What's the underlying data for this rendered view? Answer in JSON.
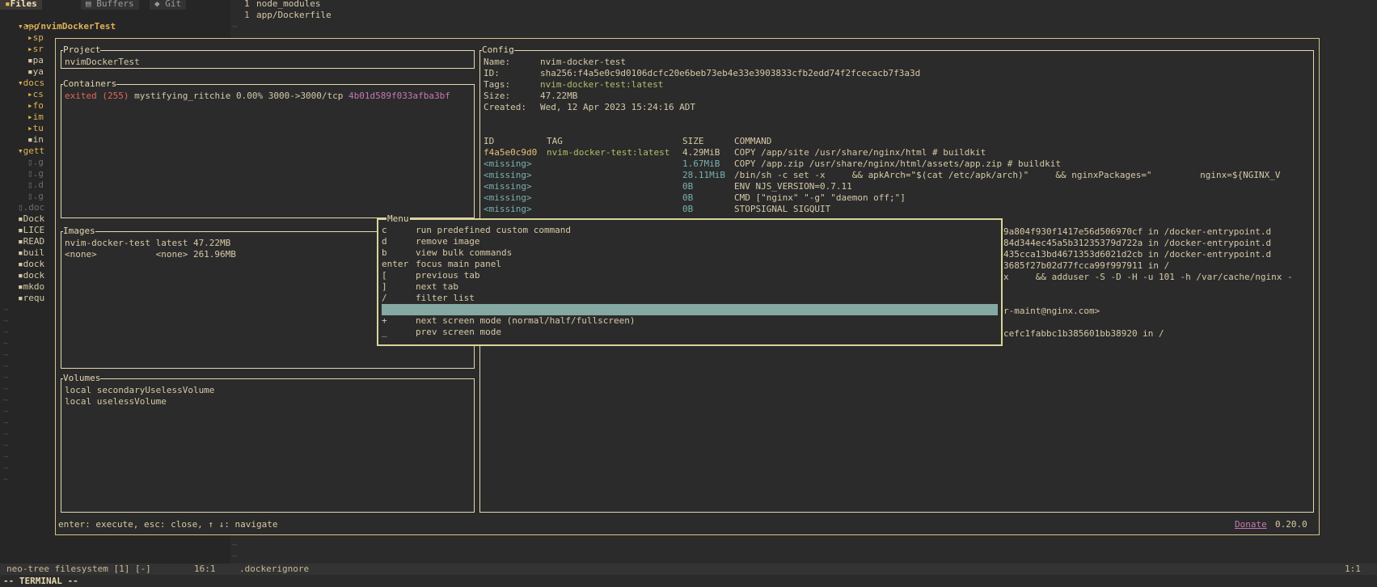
{
  "tabs": {
    "files": "Files",
    "buffers": "Buffers",
    "git": "Git"
  },
  "tree": {
    "root": "~/nvimDockerTest",
    "rows": [
      {
        "indent": 1,
        "icon": "▾",
        "name": "app",
        "type": "dir"
      },
      {
        "indent": 2,
        "icon": "▸",
        "name": "sp",
        "type": "dir"
      },
      {
        "indent": 2,
        "icon": "▸",
        "name": "sr",
        "type": "dir"
      },
      {
        "indent": 2,
        "icon": "",
        "name": "pa",
        "type": "file"
      },
      {
        "indent": 2,
        "icon": "",
        "name": "ya",
        "type": "file"
      },
      {
        "indent": 1,
        "icon": "▾",
        "name": "docs",
        "type": "dir"
      },
      {
        "indent": 2,
        "icon": "▸",
        "name": "cs",
        "type": "dir"
      },
      {
        "indent": 2,
        "icon": "▸",
        "name": "fo",
        "type": "dir"
      },
      {
        "indent": 2,
        "icon": "▸",
        "name": "im",
        "type": "dir"
      },
      {
        "indent": 2,
        "icon": "▸",
        "name": "tu",
        "type": "dir"
      },
      {
        "indent": 2,
        "icon": "",
        "name": "in",
        "type": "file"
      },
      {
        "indent": 1,
        "icon": "▾",
        "name": "gett",
        "type": "dir"
      },
      {
        "indent": 2,
        "icon": "",
        "name": ".g",
        "type": "hidden"
      },
      {
        "indent": 2,
        "icon": "",
        "name": ".g",
        "type": "hidden"
      },
      {
        "indent": 2,
        "icon": "",
        "name": ".d",
        "type": "hidden"
      },
      {
        "indent": 2,
        "icon": "",
        "name": ".g",
        "type": "hidden"
      },
      {
        "indent": 1,
        "icon": "",
        "name": ".doc",
        "type": "hidden"
      },
      {
        "indent": 1,
        "icon": "",
        "name": "Dock",
        "type": "file"
      },
      {
        "indent": 1,
        "icon": "",
        "name": "LICE",
        "type": "file"
      },
      {
        "indent": 1,
        "icon": "",
        "name": "READ",
        "type": "file"
      },
      {
        "indent": 1,
        "icon": "",
        "name": "buil",
        "type": "file"
      },
      {
        "indent": 1,
        "icon": "",
        "name": "dock",
        "type": "file"
      },
      {
        "indent": 1,
        "icon": "",
        "name": "dock",
        "type": "file"
      },
      {
        "indent": 1,
        "icon": "",
        "name": "mkdo",
        "type": "file"
      },
      {
        "indent": 1,
        "icon": "",
        "name": "requ",
        "type": "file"
      }
    ]
  },
  "file": {
    "lines": [
      {
        "num": "1",
        "text": "node_modules"
      },
      {
        "num": "1",
        "text": "app/Dockerfile"
      }
    ]
  },
  "lazydocker": {
    "project": {
      "title": "Project",
      "name": "nvimDockerTest"
    },
    "containers": {
      "title": "Containers",
      "row": {
        "status": "exited (255)",
        "name": "mystifying_ritchie",
        "cpu": "0.00%",
        "ports": "3000->3000/tcp",
        "id": "4b01d589f033afba3bf"
      }
    },
    "images": {
      "title": "Images",
      "rows": [
        "nvim-docker-test latest 47.22MB",
        "<none>           <none> 261.96MB"
      ]
    },
    "volumes": {
      "title": "Volumes",
      "rows": [
        "local secondaryUselessVolume",
        "local uselessVolume"
      ]
    },
    "config": {
      "title": "Config",
      "fields": [
        {
          "label": "Name:",
          "value": "nvim-docker-test"
        },
        {
          "label": "ID:",
          "value": "sha256:f4a5e0c9d0106dcfc20e6beb73eb4e33e3903833cfb2edd74f2fcecacb7f3a3d"
        },
        {
          "label": "Tags:",
          "value": "nvim-docker-test:latest"
        },
        {
          "label": "Size:",
          "value": "47.22MB"
        },
        {
          "label": "Created:",
          "value": "Wed, 12 Apr 2023 15:24:16 ADT"
        }
      ],
      "history_header": [
        "ID",
        "TAG",
        "SIZE",
        "COMMAND"
      ],
      "history": [
        {
          "id": "f4a5e0c9d0",
          "tag": "nvim-docker-test:latest",
          "size": "4.29MiB",
          "command": "COPY /app/site /usr/share/nginx/html # buildkit"
        },
        {
          "id": "<missing>",
          "tag": "",
          "size": "1.67MiB",
          "command": "COPY /app.zip /usr/share/nginx/html/assets/app.zip # buildkit"
        },
        {
          "id": "<missing>",
          "tag": "",
          "size": "28.11MiB",
          "command": "/bin/sh -c set -x     && apkArch=\"$(cat /etc/apk/arch)\"     && nginxPackages=\"         nginx=${NGINX_V"
        },
        {
          "id": "<missing>",
          "tag": "",
          "size": "0B",
          "command": "ENV NJS_VERSION=0.7.11"
        },
        {
          "id": "<missing>",
          "tag": "",
          "size": "0B",
          "command": "CMD [\"nginx\" \"-g\" \"daemon off;\"]"
        },
        {
          "id": "<missing>",
          "tag": "",
          "size": "0B",
          "command": "STOPSIGNAL SIGQUIT"
        }
      ],
      "tail_lines": [
        "9a804f930f1417e56d506970cf in /docker-entrypoint.d",
        "84d344ec45a5b31235379d722a in /docker-entrypoint.d",
        "435cca13bd4671353d6021d2cb in /docker-entrypoint.d",
        "3685f27b02d77fcca99f997911 in /",
        "x     && adduser -S -D -H -u 101 -h /var/cache/nginx -",
        "",
        "",
        "r-maint@nginx.com>",
        "",
        "cefc1fabbc1b385601bb38920 in /"
      ]
    },
    "menu": {
      "title": "Menu",
      "items": [
        {
          "key": "c",
          "label": "run predefined custom command"
        },
        {
          "key": "d",
          "label": "remove image"
        },
        {
          "key": "b",
          "label": "view bulk commands"
        },
        {
          "key": "enter",
          "label": "focus main panel"
        },
        {
          "key": "[",
          "label": "previous tab"
        },
        {
          "key": "]",
          "label": "next tab"
        },
        {
          "key": "/",
          "label": "filter list"
        },
        {
          "key": "",
          "label": ""
        },
        {
          "key": "+",
          "label": "next screen mode (normal/half/fullscreen)"
        },
        {
          "key": "_",
          "label": "prev screen mode"
        }
      ],
      "selected_index": 7
    },
    "footer": {
      "hint": "enter: execute, esc: close, ↑ ↓: navigate",
      "donate": "Donate",
      "version": "0.20.0"
    }
  },
  "statusline": {
    "left": "neo-tree filesystem [1] [-]",
    "pos": "16:1",
    "file": ".dockerignore",
    "right": "1:1"
  },
  "modeline": "-- TERMINAL --",
  "colors": {
    "background": "#2b2b2b",
    "accent": "#e6d8b0",
    "selection": "#85a8a3",
    "exited": "#e0665e",
    "link": "#c678b3"
  }
}
